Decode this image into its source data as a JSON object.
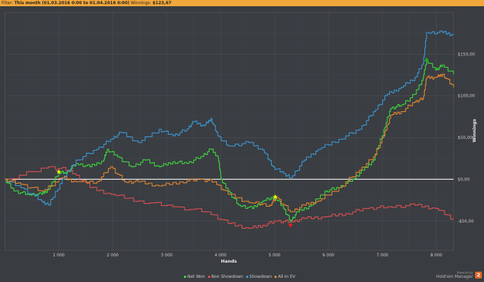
{
  "filter": {
    "label": "Filter:",
    "value": "This month (01.03.2016 0:00 to 01.04.2016 0:00)",
    "winnings_label": "Winnings:",
    "winnings_value": "$123,67"
  },
  "chart_data": {
    "type": "line",
    "xlabel": "Hands",
    "ylabel": "Winnings",
    "xlim": [
      0,
      8320
    ],
    "ylim": [
      -85,
      200
    ],
    "x_ticks": [
      1000,
      2000,
      3000,
      4000,
      5000,
      6000,
      7000,
      8000
    ],
    "x_tick_labels": [
      "1 000",
      "2 000",
      "3 000",
      "4 000",
      "5 000",
      "6 000",
      "7 000",
      "8 000"
    ],
    "y_ticks": [
      150,
      100,
      50,
      0,
      -50
    ],
    "y_tick_labels": [
      "$150,00",
      "$100,00",
      "$50,00",
      "$0,00",
      "-$50,00"
    ],
    "grid": true,
    "legend_position": "bottom",
    "series": [
      {
        "name": "Net Won",
        "color": "#3ddc3d",
        "points": [
          [
            0,
            0
          ],
          [
            167,
            -14
          ],
          [
            423,
            -18
          ],
          [
            680,
            -18
          ],
          [
            808,
            -12
          ],
          [
            1000,
            9
          ],
          [
            1128,
            7
          ],
          [
            1320,
            19
          ],
          [
            1577,
            15
          ],
          [
            1833,
            23
          ],
          [
            1897,
            36
          ],
          [
            2090,
            27
          ],
          [
            2346,
            15
          ],
          [
            2603,
            23
          ],
          [
            2859,
            15
          ],
          [
            3115,
            21
          ],
          [
            3372,
            19
          ],
          [
            3628,
            27
          ],
          [
            3820,
            36
          ],
          [
            3949,
            27
          ],
          [
            4013,
            0
          ],
          [
            4141,
            -14
          ],
          [
            4333,
            -31
          ],
          [
            4590,
            -35
          ],
          [
            4782,
            -26
          ],
          [
            5013,
            -21
          ],
          [
            5167,
            -35
          ],
          [
            5295,
            -50
          ],
          [
            5423,
            -39
          ],
          [
            5679,
            -31
          ],
          [
            5936,
            -14
          ],
          [
            6192,
            -10
          ],
          [
            6449,
            0
          ],
          [
            6641,
            11
          ],
          [
            6833,
            23
          ],
          [
            7026,
            60
          ],
          [
            7154,
            85
          ],
          [
            7346,
            89
          ],
          [
            7603,
            102
          ],
          [
            7756,
            122
          ],
          [
            7820,
            143
          ],
          [
            7987,
            131
          ],
          [
            8115,
            137
          ],
          [
            8320,
            126
          ]
        ]
      },
      {
        "name": "Non Showdown",
        "color": "#e05050",
        "points": [
          [
            0,
            0
          ],
          [
            808,
            15
          ],
          [
            1195,
            11
          ],
          [
            1577,
            -10
          ],
          [
            1962,
            -18
          ],
          [
            2474,
            -26
          ],
          [
            3115,
            -33
          ],
          [
            3756,
            -39
          ],
          [
            4141,
            -53
          ],
          [
            4526,
            -59
          ],
          [
            4782,
            -55
          ],
          [
            5039,
            -50
          ],
          [
            5295,
            -51
          ],
          [
            5551,
            -47
          ],
          [
            5936,
            -45
          ],
          [
            6320,
            -41
          ],
          [
            6705,
            -35
          ],
          [
            7090,
            -33
          ],
          [
            7603,
            -31
          ],
          [
            7987,
            -35
          ],
          [
            8320,
            -48
          ]
        ]
      },
      {
        "name": "Showdown",
        "color": "#3a9ad9",
        "points": [
          [
            0,
            0
          ],
          [
            295,
            -10
          ],
          [
            680,
            -26
          ],
          [
            808,
            -31
          ],
          [
            1064,
            0
          ],
          [
            1320,
            23
          ],
          [
            1705,
            36
          ],
          [
            1962,
            48
          ],
          [
            2154,
            56
          ],
          [
            2474,
            44
          ],
          [
            2859,
            60
          ],
          [
            3115,
            52
          ],
          [
            3372,
            60
          ],
          [
            3500,
            69
          ],
          [
            3692,
            64
          ],
          [
            3820,
            73
          ],
          [
            3949,
            52
          ],
          [
            4141,
            40
          ],
          [
            4526,
            44
          ],
          [
            4782,
            35
          ],
          [
            4974,
            15
          ],
          [
            5167,
            7
          ],
          [
            5295,
            2
          ],
          [
            5551,
            23
          ],
          [
            5808,
            36
          ],
          [
            6192,
            48
          ],
          [
            6577,
            60
          ],
          [
            6833,
            81
          ],
          [
            7090,
            102
          ],
          [
            7346,
            110
          ],
          [
            7603,
            122
          ],
          [
            7756,
            139
          ],
          [
            7820,
            176
          ],
          [
            8115,
            176
          ],
          [
            8320,
            173
          ]
        ]
      },
      {
        "name": "All-In EV",
        "color": "#e8892c",
        "points": [
          [
            0,
            0
          ],
          [
            295,
            -6
          ],
          [
            680,
            -14
          ],
          [
            1064,
            2
          ],
          [
            1320,
            -3
          ],
          [
            1705,
            -3
          ],
          [
            1962,
            15
          ],
          [
            2218,
            -3
          ],
          [
            2474,
            -3
          ],
          [
            2859,
            -8
          ],
          [
            3244,
            -3
          ],
          [
            3628,
            0
          ],
          [
            3885,
            -3
          ],
          [
            4141,
            -18
          ],
          [
            4526,
            -28
          ],
          [
            4910,
            -31
          ],
          [
            5039,
            -22
          ],
          [
            5295,
            -39
          ],
          [
            5551,
            -31
          ],
          [
            5808,
            -26
          ],
          [
            6192,
            -10
          ],
          [
            6577,
            11
          ],
          [
            6833,
            27
          ],
          [
            7026,
            52
          ],
          [
            7154,
            77
          ],
          [
            7346,
            81
          ],
          [
            7603,
            93
          ],
          [
            7756,
            97
          ],
          [
            7820,
            122
          ],
          [
            7987,
            122
          ],
          [
            8115,
            126
          ],
          [
            8320,
            110
          ]
        ]
      }
    ],
    "markers": [
      {
        "kind": "star",
        "color": "#f5f500",
        "x": 1000,
        "y": 9
      },
      {
        "kind": "star",
        "color": "#f5f500",
        "x": 5013,
        "y": -21
      },
      {
        "kind": "triangle-up",
        "color": "#1faa1f",
        "x": 7820,
        "y": 143
      },
      {
        "kind": "triangle-down",
        "color": "#e02020",
        "x": 5295,
        "y": -55
      }
    ]
  },
  "brand": {
    "powered": "Powered by",
    "name": "Hold'em Manager",
    "logo": "2"
  }
}
